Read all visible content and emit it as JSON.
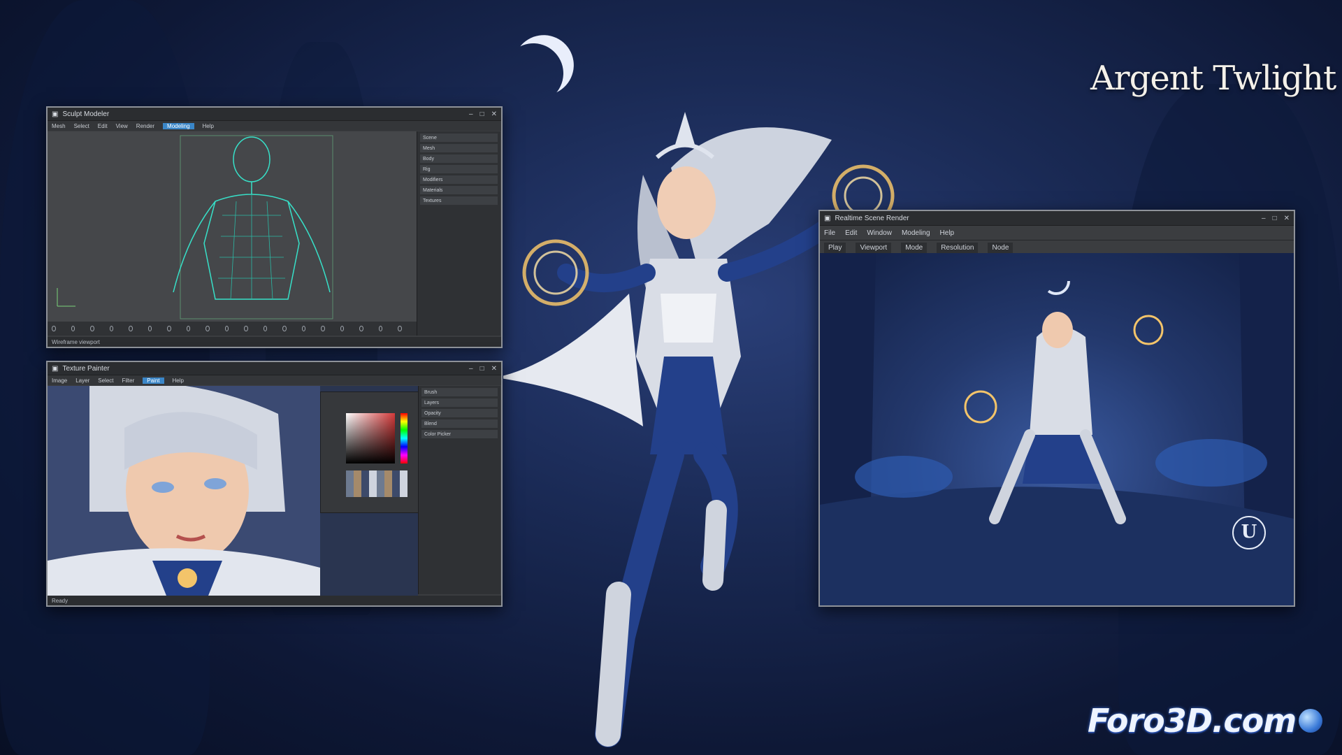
{
  "poster": {
    "title": "Argent Twlight",
    "logo_text": "Foro3D.com"
  },
  "window_modeling": {
    "title": "Sculpt Modeler",
    "menu": [
      "Mesh",
      "Select",
      "Edit",
      "View",
      "Render",
      "Modeling",
      "Help"
    ],
    "active_menu": "Modeling",
    "status": "Wireframe viewport",
    "panel_items": [
      "Scene",
      "Mesh",
      "Body",
      "Rig",
      "Modifiers",
      "Materials",
      "Textures"
    ]
  },
  "window_texture": {
    "title": "Texture Painter",
    "menu": [
      "Image",
      "Layer",
      "Select",
      "Filter",
      "Paint",
      "Help"
    ],
    "active_menu": "Paint",
    "status": "Ready",
    "panel_items": [
      "Brush",
      "Layers",
      "Opacity",
      "Blend",
      "Color Picker"
    ]
  },
  "window_engine": {
    "title": "Realtime Scene Render",
    "menu": [
      "File",
      "Edit",
      "Window",
      "Modeling",
      "Help"
    ],
    "toolbar": [
      "Play",
      "Viewport",
      "Mode",
      "Resolution",
      "Node"
    ]
  },
  "colors": {
    "accent": "#3a86c8",
    "wire": "#37e0c8",
    "armor_blue": "#23408a",
    "silver": "#d9dde6",
    "glow": "#f3c46a"
  }
}
